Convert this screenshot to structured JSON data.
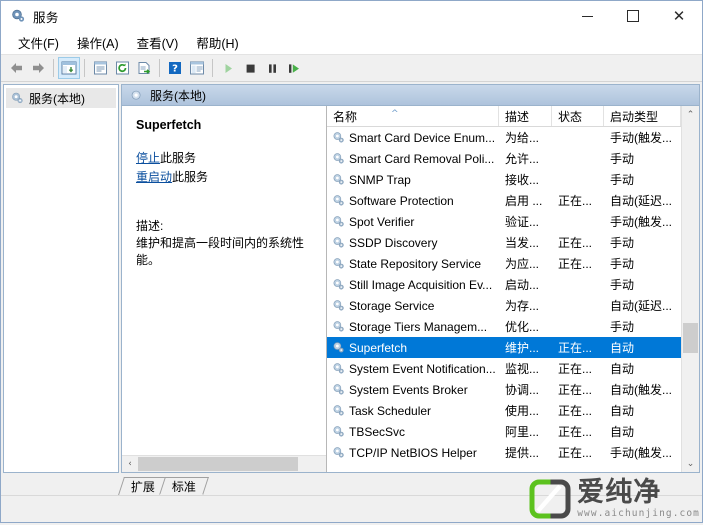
{
  "window": {
    "title": "服务",
    "icon": "services-gear-icon",
    "controls": {
      "minimize": "—",
      "maximize": "□",
      "close": "✕"
    }
  },
  "menubar": {
    "items": [
      {
        "label": "文件(F)",
        "name": "menu-file"
      },
      {
        "label": "操作(A)",
        "name": "menu-action"
      },
      {
        "label": "查看(V)",
        "name": "menu-view"
      },
      {
        "label": "帮助(H)",
        "name": "menu-help"
      }
    ]
  },
  "toolbar": {
    "buttons": [
      {
        "name": "back-icon",
        "glyph": "←"
      },
      {
        "name": "forward-icon",
        "glyph": "→"
      },
      {
        "name": "show-hide-tree-icon",
        "glyph": "▤"
      },
      {
        "name": "properties-icon",
        "glyph": "▤"
      },
      {
        "name": "refresh-icon",
        "glyph": "⟳"
      },
      {
        "name": "export-list-icon",
        "glyph": "⇨"
      },
      {
        "name": "help-icon",
        "glyph": "?"
      },
      {
        "name": "list-view-icon",
        "glyph": "▤"
      },
      {
        "name": "start-service-icon",
        "glyph": "▶"
      },
      {
        "name": "stop-service-icon",
        "glyph": "■"
      },
      {
        "name": "pause-service-icon",
        "glyph": "❚❚"
      },
      {
        "name": "restart-service-icon",
        "glyph": "▶❚"
      }
    ]
  },
  "tree": {
    "root_label": "服务(本地)"
  },
  "right_pane": {
    "header_label": "服务(本地)"
  },
  "details": {
    "service_name": "Superfetch",
    "stop_link": "停止",
    "stop_suffix": "此服务",
    "restart_link": "重启动",
    "restart_suffix": "此服务",
    "description_label": "描述:",
    "description_text": "维护和提高一段时间内的系统性能。"
  },
  "list": {
    "columns": [
      {
        "label": "名称",
        "name": "column-name"
      },
      {
        "label": "描述",
        "name": "column-description"
      },
      {
        "label": "状态",
        "name": "column-status"
      },
      {
        "label": "启动类型",
        "name": "column-startup-type"
      }
    ],
    "sort_indicator": "^",
    "sort_column": "名称",
    "selected_row_index": 10,
    "rows": [
      {
        "name": "Smart Card Device Enum...",
        "description": "为给...",
        "status": "",
        "startup": "手动(触发..."
      },
      {
        "name": "Smart Card Removal Poli...",
        "description": "允许...",
        "status": "",
        "startup": "手动"
      },
      {
        "name": "SNMP Trap",
        "description": "接收...",
        "status": "",
        "startup": "手动"
      },
      {
        "name": "Software Protection",
        "description": "启用 ...",
        "status": "正在...",
        "startup": "自动(延迟..."
      },
      {
        "name": "Spot Verifier",
        "description": "验证...",
        "status": "",
        "startup": "手动(触发..."
      },
      {
        "name": "SSDP Discovery",
        "description": "当发...",
        "status": "正在...",
        "startup": "手动"
      },
      {
        "name": "State Repository Service",
        "description": "为应...",
        "status": "正在...",
        "startup": "手动"
      },
      {
        "name": "Still Image Acquisition Ev...",
        "description": "启动...",
        "status": "",
        "startup": "手动"
      },
      {
        "name": "Storage Service",
        "description": "为存...",
        "status": "",
        "startup": "自动(延迟..."
      },
      {
        "name": "Storage Tiers Managem...",
        "description": "优化...",
        "status": "",
        "startup": "手动"
      },
      {
        "name": "Superfetch",
        "description": "维护...",
        "status": "正在...",
        "startup": "自动"
      },
      {
        "name": "System Event Notification...",
        "description": "监视...",
        "status": "正在...",
        "startup": "自动"
      },
      {
        "name": "System Events Broker",
        "description": "协调...",
        "status": "正在...",
        "startup": "自动(触发..."
      },
      {
        "name": "Task Scheduler",
        "description": "使用...",
        "status": "正在...",
        "startup": "自动"
      },
      {
        "name": "TBSecSvc",
        "description": "阿里...",
        "status": "正在...",
        "startup": "自动"
      },
      {
        "name": "TCP/IP NetBIOS Helper",
        "description": "提供...",
        "status": "正在...",
        "startup": "手动(触发..."
      }
    ],
    "scrollbar": {
      "up_arrow": "⌃",
      "down_arrow": "⌄",
      "left_arrow": "‹"
    }
  },
  "tabs": [
    {
      "label": "扩展",
      "name": "tab-extended",
      "active": false
    },
    {
      "label": "标准",
      "name": "tab-standard",
      "active": true
    }
  ],
  "watermark": {
    "brand": "爱纯净",
    "url": "www.aichunjing.com",
    "green": "#5cc21e",
    "gray": "#4a4a4a"
  },
  "colors": {
    "selection_blue": "#0078d7",
    "link_blue": "#0b4f9e",
    "pane_border": "#9bb3cc"
  }
}
